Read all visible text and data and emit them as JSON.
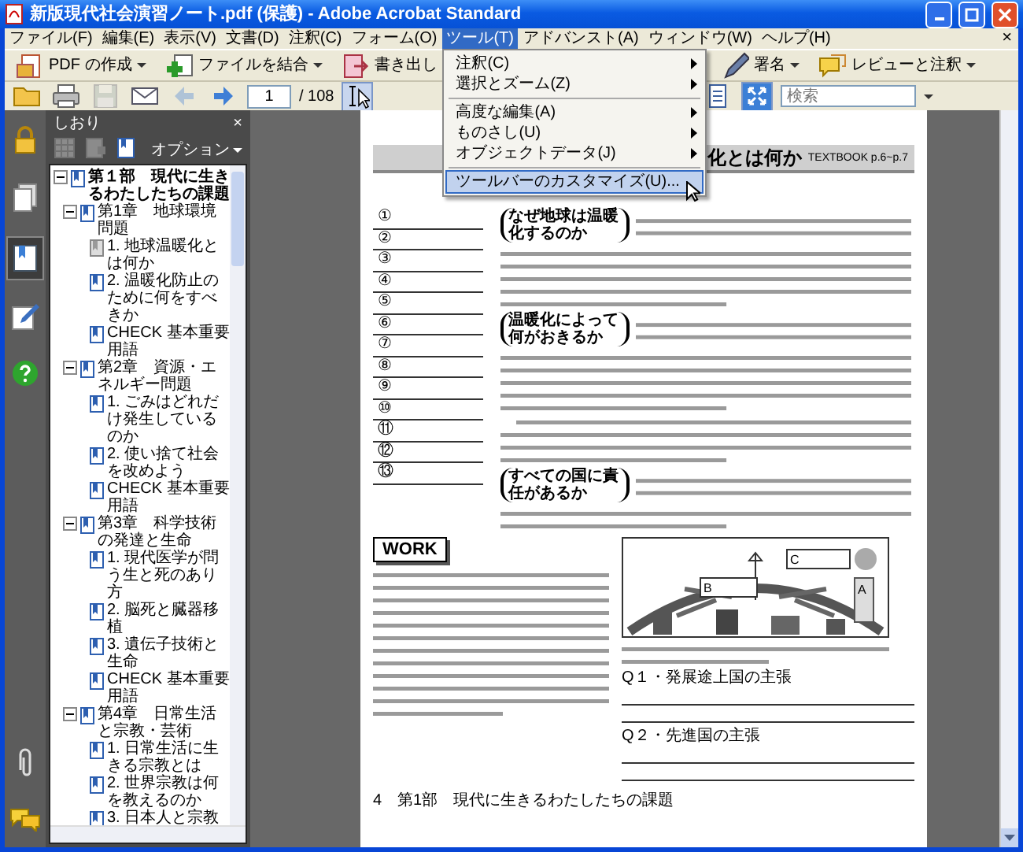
{
  "window": {
    "title": "新版現代社会演習ノート.pdf (保護) - Adobe Acrobat Standard"
  },
  "menu_bar": {
    "items": [
      {
        "label": "ファイル(F)",
        "selected": false
      },
      {
        "label": "編集(E)",
        "selected": false
      },
      {
        "label": "表示(V)",
        "selected": false
      },
      {
        "label": "文書(D)",
        "selected": false
      },
      {
        "label": "注釈(C)",
        "selected": false
      },
      {
        "label": "フォーム(O)",
        "selected": false
      },
      {
        "label": "ツール(T)",
        "selected": true
      },
      {
        "label": "アドバンスト(A)",
        "selected": false
      },
      {
        "label": "ウィンドウ(W)",
        "selected": false
      },
      {
        "label": "ヘルプ(H)",
        "selected": false
      }
    ],
    "close": "×"
  },
  "tools_menu": [
    {
      "kind": "submenu",
      "label": "注釈(C)",
      "selected": false
    },
    {
      "kind": "submenu",
      "label": "選択とズーム(Z)",
      "selected": false
    },
    {
      "kind": "separator"
    },
    {
      "kind": "submenu",
      "label": "高度な編集(A)",
      "selected": false
    },
    {
      "kind": "submenu",
      "label": "ものさし(U)",
      "selected": false
    },
    {
      "kind": "submenu",
      "label": "オブジェクトデータ(J)",
      "selected": false
    },
    {
      "kind": "separator"
    },
    {
      "kind": "item",
      "label": "ツールバーのカスタマイズ(U)...",
      "selected": true
    }
  ],
  "toolbar": {
    "left": [
      {
        "kind": "create",
        "label": "PDF の作成"
      },
      {
        "kind": "combine",
        "label": "ファイルを結合"
      },
      {
        "kind": "export",
        "label": "書き出し"
      }
    ],
    "right": [
      {
        "kind": "sign",
        "label": "署名"
      },
      {
        "kind": "review",
        "label": "レビューと注釈"
      }
    ]
  },
  "nav_toolbar": {
    "tools": [
      {
        "kind": "open",
        "disabled": false
      },
      {
        "kind": "print",
        "disabled": false
      },
      {
        "kind": "save",
        "disabled": true
      },
      {
        "kind": "email",
        "disabled": false
      },
      {
        "kind": "back",
        "disabled": true
      },
      {
        "kind": "forward",
        "disabled": false
      }
    ],
    "page": "1",
    "page_count": "/ 108",
    "view_tools": [
      {
        "kind": "select",
        "selected": true
      }
    ],
    "right_tools": [
      {
        "kind": "page",
        "selected": false
      },
      {
        "kind": "fit",
        "selected": true
      }
    ],
    "search_placeholder": "検索"
  },
  "side_strip": {
    "top": [
      {
        "kind": "lock",
        "selected": false
      },
      {
        "kind": "pages",
        "selected": false
      },
      {
        "kind": "bookmarks",
        "selected": true
      },
      {
        "kind": "signpen",
        "selected": false
      },
      {
        "kind": "help",
        "selected": false
      }
    ],
    "bottom": [
      {
        "kind": "attach",
        "selected": false
      },
      {
        "kind": "comments",
        "selected": false
      }
    ]
  },
  "bookmarks_panel": {
    "title": "しおり",
    "close": "×",
    "options": "オプション",
    "tools": [
      {
        "kind": "grid",
        "disabled": true
      },
      {
        "kind": "tag",
        "disabled": true
      },
      {
        "kind": "new",
        "disabled": false
      }
    ],
    "items": [
      {
        "label": "第１部　現代に生きるわたしたちの課題",
        "expanded": true,
        "selected": false,
        "children": [
          {
            "label": "第1章　地球環境問題",
            "expanded": true,
            "selected": false,
            "children": [
              {
                "label": "1. 地球温暖化とは何か",
                "selected": true
              },
              {
                "label": "2. 温暖化防止のために何をすべきか",
                "selected": false
              },
              {
                "label": "CHECK 基本重要用語",
                "selected": false
              }
            ]
          },
          {
            "label": "第2章　資源・エネルギー問題",
            "expanded": true,
            "selected": false,
            "children": [
              {
                "label": "1. ごみはどれだけ発生しているのか",
                "selected": false
              },
              {
                "label": "2. 使い捨て社会を改めよう",
                "selected": false
              },
              {
                "label": "CHECK 基本重要用語",
                "selected": false
              }
            ]
          },
          {
            "label": "第3章　科学技術の発達と生命",
            "expanded": true,
            "selected": false,
            "children": [
              {
                "label": "1. 現代医学が問う生と死のあり方",
                "selected": false
              },
              {
                "label": "2. 脳死と臓器移植",
                "selected": false
              },
              {
                "label": "3. 遺伝子技術と生命",
                "selected": false
              },
              {
                "label": "CHECK 基本重要用語",
                "selected": false
              }
            ]
          },
          {
            "label": "第4章　日常生活と宗教・芸術",
            "expanded": true,
            "selected": false,
            "children": [
              {
                "label": "1. 日常生活に生きる宗教とは",
                "selected": false
              },
              {
                "label": "2. 世界宗教は何を教えるのか",
                "selected": false
              },
              {
                "label": "3. 日本人と宗教",
                "selected": false
              }
            ]
          }
        ]
      }
    ]
  },
  "page": {
    "section_title": "化とは何か",
    "textbook_ref": "TEXTBOOK p.6~p.7",
    "answer_numbers": [
      "①",
      "②",
      "③",
      "④",
      "⑤",
      "⑥",
      "⑦",
      "⑧",
      "⑨",
      "⑩",
      "⑪",
      "⑫",
      "⑬"
    ],
    "topics": [
      {
        "label": "なぜ地球は温暖化するのか"
      },
      {
        "label": "温暖化によって何がおきるか"
      },
      {
        "label": "すべての国に責任があるか"
      }
    ],
    "work": {
      "title": "WORK",
      "figure_labels": [
        "C",
        "B",
        "A"
      ],
      "questions": [
        "Q１・発展途上国の主張",
        "Q２・先進国の主張"
      ]
    },
    "footer": "4　第1部　現代に生きるわたしたちの課題"
  }
}
